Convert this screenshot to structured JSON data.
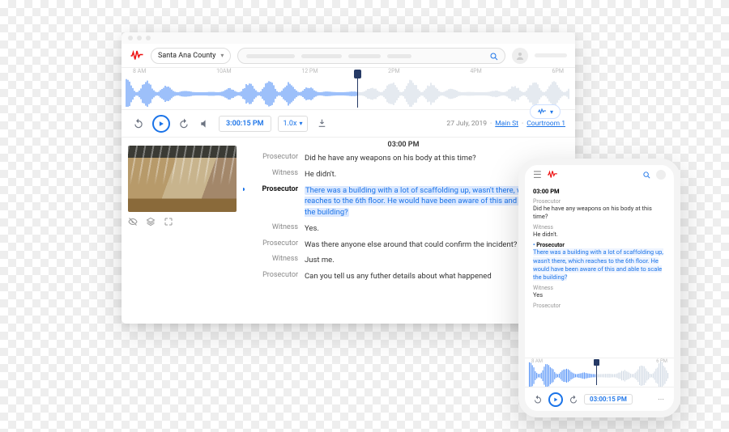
{
  "header": {
    "location_dropdown": "Santa Ana County",
    "search_placeholder": ""
  },
  "timeline": {
    "ticks": [
      "8 AM",
      "10AM",
      "12 PM",
      "2PM",
      "4PM",
      "6PM"
    ],
    "bubble_icon": "waveform"
  },
  "controls": {
    "timestamp": "3:00:15 PM",
    "speed": "1.0x",
    "date": "27 July, 2019",
    "location_link": "Main St",
    "room_link": "Courtroom 1"
  },
  "transcript": {
    "time_header": "03:00 PM",
    "lines": [
      {
        "speaker": "Prosecutor",
        "text": "Did he have any weapons on his body at this time?",
        "active": false
      },
      {
        "speaker": "Witness",
        "text": "He didn't.",
        "active": false
      },
      {
        "speaker": "Prosecutor",
        "text": "There was a building with a lot of scaffolding up, wasn't there, which reaches to the 6th floor. He would have been aware of this and able to scale the building?",
        "active": true
      },
      {
        "speaker": "Witness",
        "text": "Yes.",
        "active": false
      },
      {
        "speaker": "Prosecutor",
        "text": "Was there anyone else around that could confirm the incident?",
        "active": false
      },
      {
        "speaker": "Witness",
        "text": "Just me.",
        "active": false
      },
      {
        "speaker": "Prosecutor",
        "text": "Can you tell us any futher details about what happened",
        "active": false
      }
    ]
  },
  "mobile": {
    "time_header": "03:00 PM",
    "lines": [
      {
        "speaker": "Prosecutor",
        "text": "Did he have any weapons on his body at this time?",
        "active": false
      },
      {
        "speaker": "Witness",
        "text": "He didn't.",
        "active": false
      },
      {
        "speaker": "Prosecutor",
        "text": "There was a building with a lot of scaffolding up, wasn't there, which reaches to the 6th floor. He would have been aware of this and able to scale the building?",
        "active": true
      },
      {
        "speaker": "Witness",
        "text": "Yes",
        "active": false
      },
      {
        "speaker": "Prosecutor",
        "text": "",
        "active": false
      }
    ],
    "wave_ticks": [
      "8 AM",
      "6 PM"
    ],
    "timestamp": "03:00:15 PM"
  },
  "icons": {
    "logo": "waveform-logo",
    "search": "search",
    "avatar": "user",
    "rewind": "rewind-10",
    "play": "play",
    "forward": "forward-10",
    "volume": "volume",
    "download": "download",
    "expand": "expand",
    "image_off": "eye-off",
    "layers": "layers",
    "burger": "menu",
    "more": "more"
  }
}
